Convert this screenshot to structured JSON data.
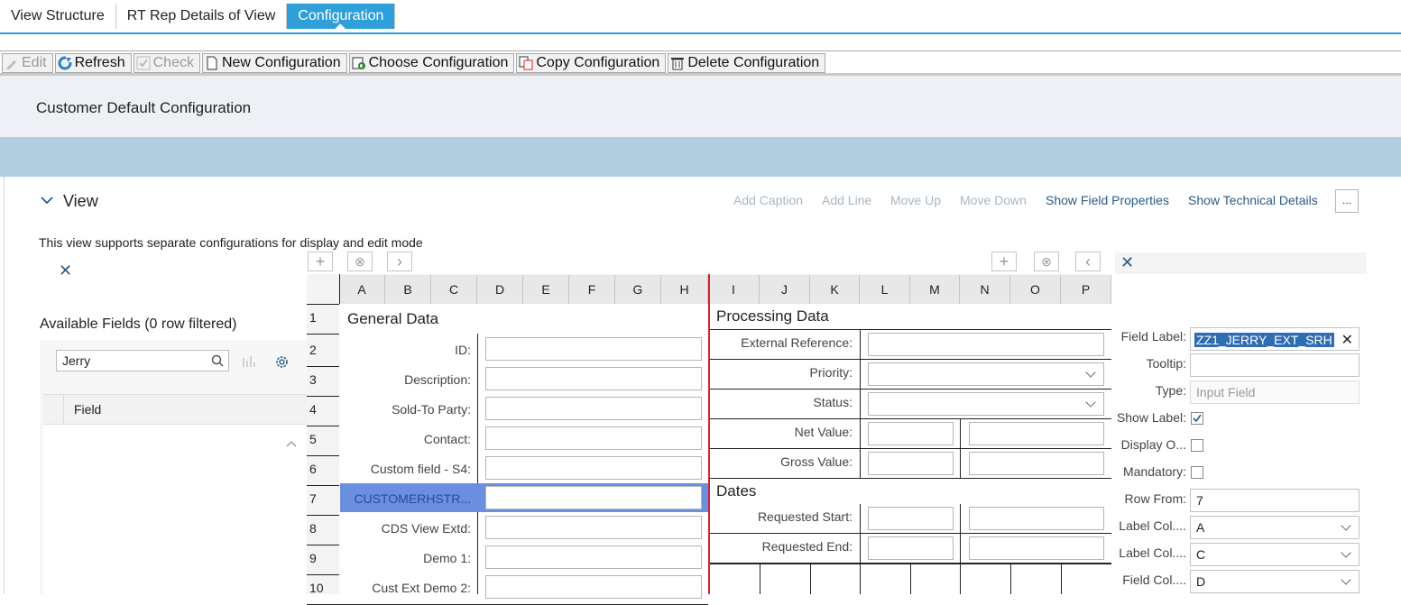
{
  "tabs": [
    "View Structure",
    "RT Rep Details of View",
    "Configuration"
  ],
  "toolbar": {
    "edit": "Edit",
    "refresh": "Refresh",
    "check": "Check",
    "new_config": "New Configuration",
    "choose_config": "Choose Configuration",
    "copy_config": "Copy Configuration",
    "delete_config": "Delete Configuration"
  },
  "header": {
    "title": "Customer Default Configuration"
  },
  "view": {
    "title": "View",
    "actions": {
      "add_caption": "Add Caption",
      "add_line": "Add Line",
      "move_up": "Move Up",
      "move_down": "Move Down",
      "show_field_props": "Show Field Properties",
      "show_tech": "Show Technical Details",
      "more": "..."
    },
    "note": "This view supports separate configurations for display and edit mode"
  },
  "available": {
    "title": "Available Fields (0 row filtered)",
    "search_value": "Jerry",
    "column": "Field"
  },
  "grid": {
    "columns": [
      "A",
      "B",
      "C",
      "D",
      "E",
      "F",
      "G",
      "H",
      "I",
      "J",
      "K",
      "L",
      "M",
      "N",
      "O",
      "P"
    ],
    "rows": [
      "1",
      "2",
      "3",
      "4",
      "5",
      "6",
      "7",
      "8",
      "9",
      "10"
    ],
    "left_section": "General Data",
    "left_fields": [
      "ID:",
      "Description:",
      "Sold-To Party:",
      "Contact:",
      "Custom field - S4:",
      "CUSTOMERHSTR...",
      "CDS View Extd:",
      "Demo 1:",
      "Cust Ext Demo 2:"
    ],
    "right_section1": "Processing Data",
    "right_fields1": [
      "External Reference:",
      "Priority:",
      "Status:",
      "Net Value:",
      "Gross Value:"
    ],
    "right_section2": "Dates",
    "right_fields2": [
      "Requested Start:",
      "Requested End:"
    ]
  },
  "properties": {
    "labels": [
      "Field Label:",
      "Tooltip:",
      "Type:",
      "Show Label:",
      "Display O...",
      "Mandatory:",
      "Row From:",
      "Label Col....",
      "Label Col....",
      "Field Col...."
    ],
    "field_label_value": "ZZ1_JERRY_EXT_SRH",
    "type_value": "Input Field",
    "row_from": "7",
    "label_col_from": "A",
    "label_col_to": "C",
    "field_col_from": "D"
  },
  "colors": {
    "accent": "#2f9fd9",
    "band": "#b2cde0",
    "selected_row": "#6b8fe0",
    "divider": "#d4232b"
  }
}
